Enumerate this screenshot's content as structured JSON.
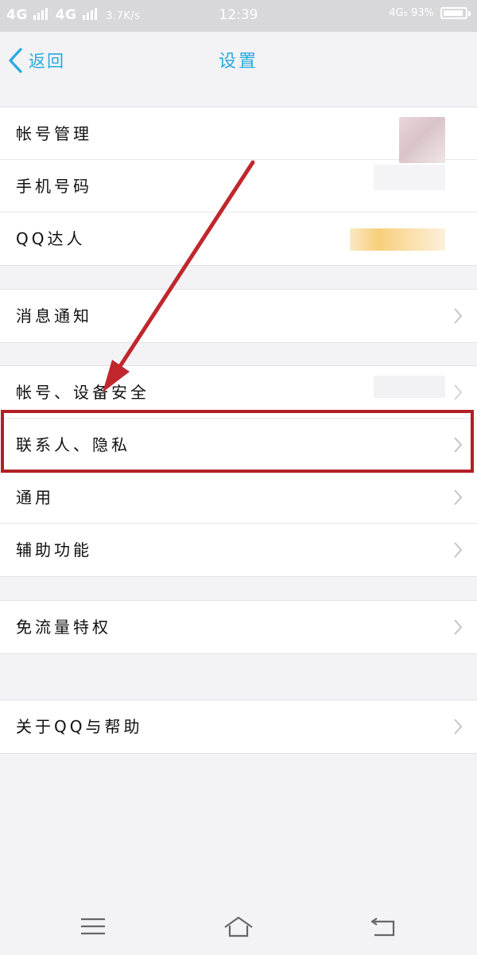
{
  "status_bar": {
    "signal1": "4G",
    "signal2": "4G",
    "net_speed": "3.7K/s",
    "time": "12:39",
    "right_info": "4G₅ 93%"
  },
  "nav": {
    "back_label": "返回",
    "title": "设置"
  },
  "groups": {
    "account": {
      "account_mgmt": "帐号管理",
      "phone_number": "手机号码",
      "qq_expert": "QQ达人"
    },
    "notification": {
      "message_notify": "消息通知"
    },
    "security": {
      "account_device_security": "帐号、设备安全",
      "contacts_privacy": "联系人、隐私",
      "general": "通用",
      "accessibility": "辅助功能"
    },
    "data": {
      "free_data": "免流量特权"
    },
    "about": {
      "about_help": "关于QQ与帮助"
    }
  },
  "colors": {
    "accent": "#27a9e1",
    "annotation": "#c0272d",
    "highlight_border": "#b31f24"
  },
  "icons": [
    "back-chevron-icon",
    "chevron-right-icon",
    "menu-icon",
    "home-icon",
    "back-nav-icon",
    "battery-icon"
  ]
}
